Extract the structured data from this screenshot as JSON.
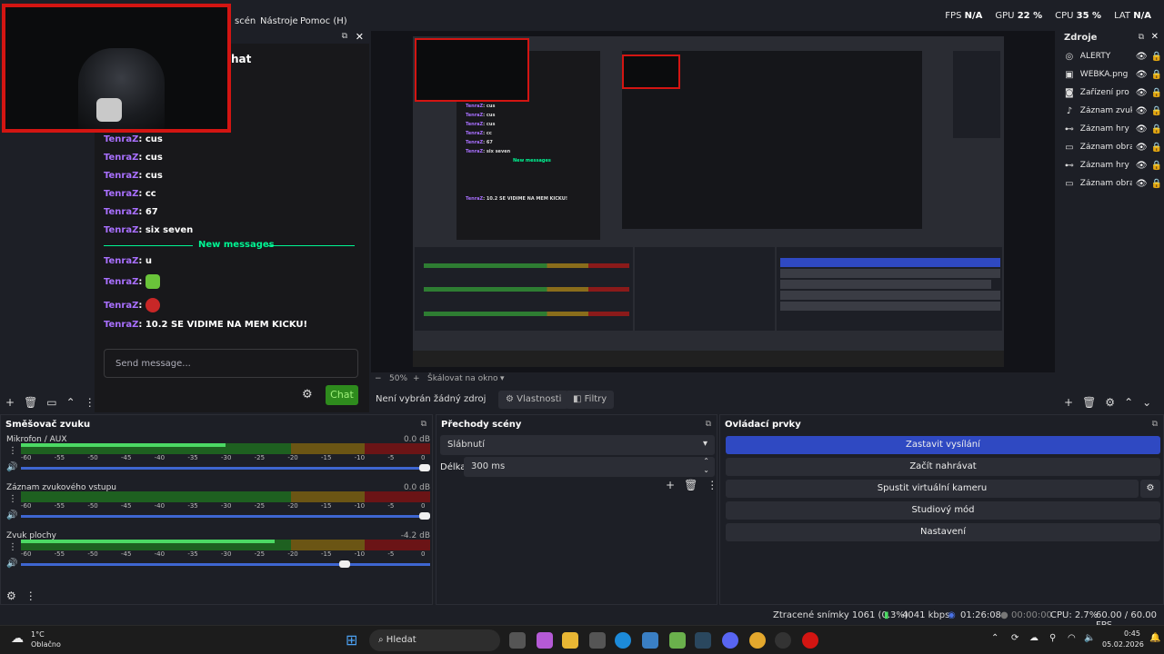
{
  "menu": {
    "scenes_label": "scén",
    "tools_label": "Nástroje",
    "help_label": "Pomoc (H)"
  },
  "stats": {
    "fps_label": "FPS",
    "fps_value": "N/A",
    "gpu_label": "GPU",
    "gpu_value": "22 %",
    "cpu_label": "CPU",
    "cpu_value": "35 %",
    "lat_label": "LAT",
    "lat_value": "N/A"
  },
  "chat": {
    "title": "hat",
    "messages": [
      {
        "user": "TenraZ",
        "text": "cus"
      },
      {
        "user": "TenraZ",
        "text": "cus"
      },
      {
        "user": "TenraZ",
        "text": "cus"
      },
      {
        "user": "TenraZ",
        "text": "cc"
      },
      {
        "user": "TenraZ",
        "text": "67"
      },
      {
        "user": "TenraZ",
        "text": "six seven"
      }
    ],
    "new_messages": "New messages",
    "after": [
      {
        "user": "TenraZ",
        "text": "u"
      },
      {
        "user": "TenraZ",
        "text": ""
      },
      {
        "user": "TenraZ",
        "text": ""
      },
      {
        "user": "TenraZ",
        "text": "10.2 SE VIDIME NA MEM KICKU!"
      }
    ],
    "input_placeholder": "Send message...",
    "send_label": "Chat",
    "user_colon": ":"
  },
  "preview": {
    "zoom": "50%",
    "scale_label": "Škálovat na okno",
    "no_source": "Není vybrán žádný zdroj",
    "properties": "Vlastnosti",
    "filters": "Filtry"
  },
  "sources": {
    "title": "Zdroje",
    "items": [
      {
        "name": "ALERTY",
        "icon": "browser-icon"
      },
      {
        "name": "WEBKA.png",
        "icon": "image-icon"
      },
      {
        "name": "Zařízení pro z",
        "icon": "camera-icon"
      },
      {
        "name": "Záznam zvuku",
        "icon": "mic-icon"
      },
      {
        "name": "Záznam hry",
        "icon": "gamepad-icon"
      },
      {
        "name": "Záznam obra",
        "icon": "monitor-icon"
      },
      {
        "name": "Záznam hry",
        "icon": "gamepad-icon"
      },
      {
        "name": "Záznam obra",
        "icon": "monitor-icon"
      }
    ]
  },
  "mixer": {
    "title": "Směšovač zvuku",
    "ticks": [
      "-60",
      "-55",
      "-50",
      "-45",
      "-40",
      "-35",
      "-30",
      "-25",
      "-20",
      "-15",
      "-10",
      "-5",
      "0"
    ],
    "channels": [
      {
        "name": "Mikrofon / AUX",
        "db": "0.0 dB",
        "level": 0.5,
        "volume": 1.0
      },
      {
        "name": "Záznam zvukového vstupu",
        "db": "0.0 dB",
        "level": 0.0,
        "volume": 1.0
      },
      {
        "name": "Zvuk plochy",
        "db": "-4.2 dB",
        "level": 0.62,
        "volume": 0.8
      }
    ]
  },
  "transitions": {
    "title": "Přechody scény",
    "selected": "Slábnutí",
    "duration_label": "Délka",
    "duration_value": "300 ms"
  },
  "controls": {
    "title": "Ovládací prvky",
    "buttons": [
      "Zastavit vysílání",
      "Začít nahrávat",
      "Spustit virtuální kameru",
      "Studiový mód",
      "Nastavení"
    ]
  },
  "status": {
    "dropped": "Ztracené snímky 1061 (0.3%)",
    "bitrate": "4041 kbps",
    "live_time": "01:26:08",
    "rec_time": "00:00:00",
    "cpu": "CPU: 2.7%",
    "fps": "60.00 / 60.00 FPS"
  },
  "taskbar": {
    "weather_temp": "1°C",
    "weather_desc": "Oblačno",
    "search": "Hledat",
    "time": "0:45",
    "date": "05.02.2026"
  },
  "nested_chat": [
    "cus",
    "cus",
    "cus",
    "cc",
    "67",
    "six seven"
  ],
  "nested_user": "TenraZ",
  "colors": {
    "accent_blue": "#2f49c2",
    "live_red": "#d31512",
    "chat_green": "#00f593",
    "twitch_purple": "#a970ff"
  }
}
